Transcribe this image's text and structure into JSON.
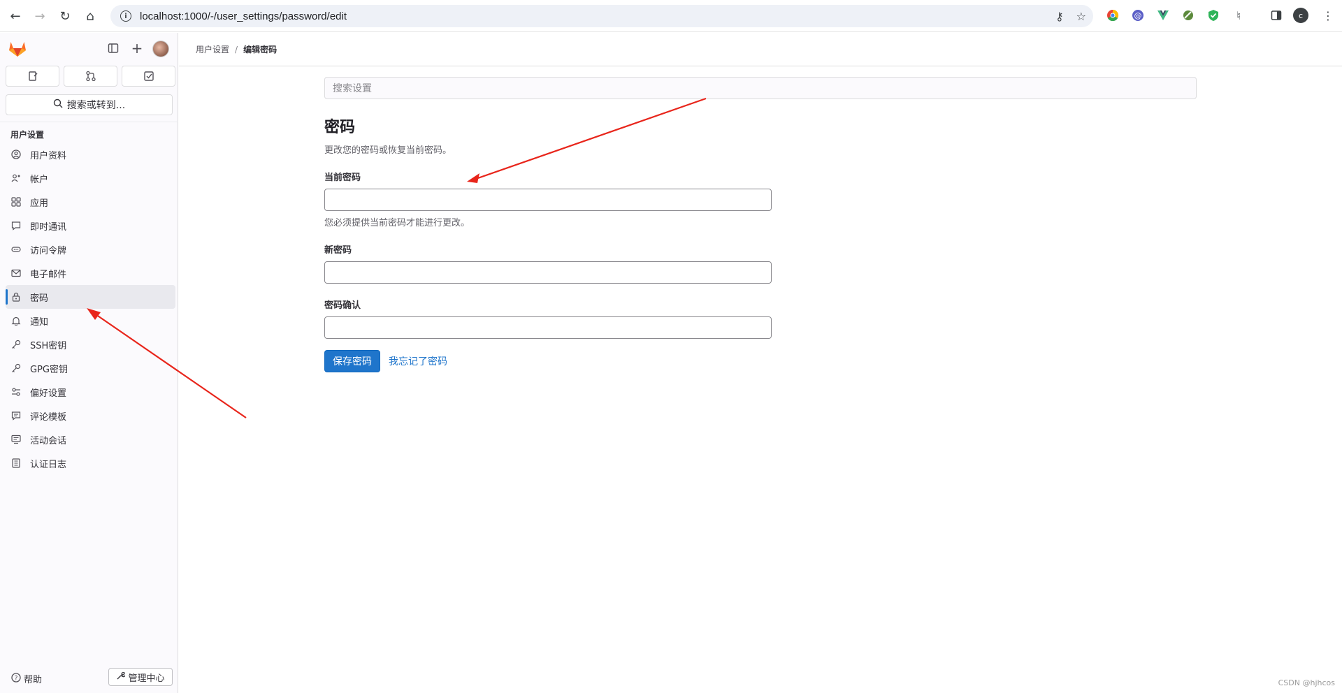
{
  "browser": {
    "url": "localhost:1000/-/user_settings/password/edit",
    "profile_initial": "c"
  },
  "sidebar": {
    "search_label": "搜索或转到...",
    "section_title": "用户设置",
    "items": [
      {
        "label": "用户资料",
        "icon": "profile-icon"
      },
      {
        "label": "帐户",
        "icon": "account-icon"
      },
      {
        "label": "应用",
        "icon": "applications-icon"
      },
      {
        "label": "即时通讯",
        "icon": "chat-icon"
      },
      {
        "label": "访问令牌",
        "icon": "token-icon"
      },
      {
        "label": "电子邮件",
        "icon": "mail-icon"
      },
      {
        "label": "密码",
        "icon": "lock-icon"
      },
      {
        "label": "通知",
        "icon": "bell-icon"
      },
      {
        "label": "SSH密钥",
        "icon": "key-icon"
      },
      {
        "label": "GPG密钥",
        "icon": "key-icon"
      },
      {
        "label": "偏好设置",
        "icon": "preferences-icon"
      },
      {
        "label": "评论模板",
        "icon": "comment-template-icon"
      },
      {
        "label": "活动会话",
        "icon": "monitor-icon"
      },
      {
        "label": "认证日志",
        "icon": "log-icon"
      }
    ],
    "active_item": "密码",
    "help_label": "帮助",
    "admin_label": "管理中心"
  },
  "breadcrumb": {
    "parent": "用户设置",
    "separator": "/",
    "current": "编辑密码"
  },
  "main": {
    "search_placeholder": "搜索设置",
    "title": "密码",
    "description": "更改您的密码或恢复当前密码。",
    "current_password_label": "当前密码",
    "current_password_help": "您必须提供当前密码才能进行更改。",
    "new_password_label": "新密码",
    "confirm_password_label": "密码确认",
    "save_button": "保存密码",
    "forgot_link": "我忘记了密码"
  },
  "watermark": "CSDN @hjhcos",
  "colors": {
    "accent": "#1f75cb",
    "annotation_arrow": "#e8251b"
  }
}
